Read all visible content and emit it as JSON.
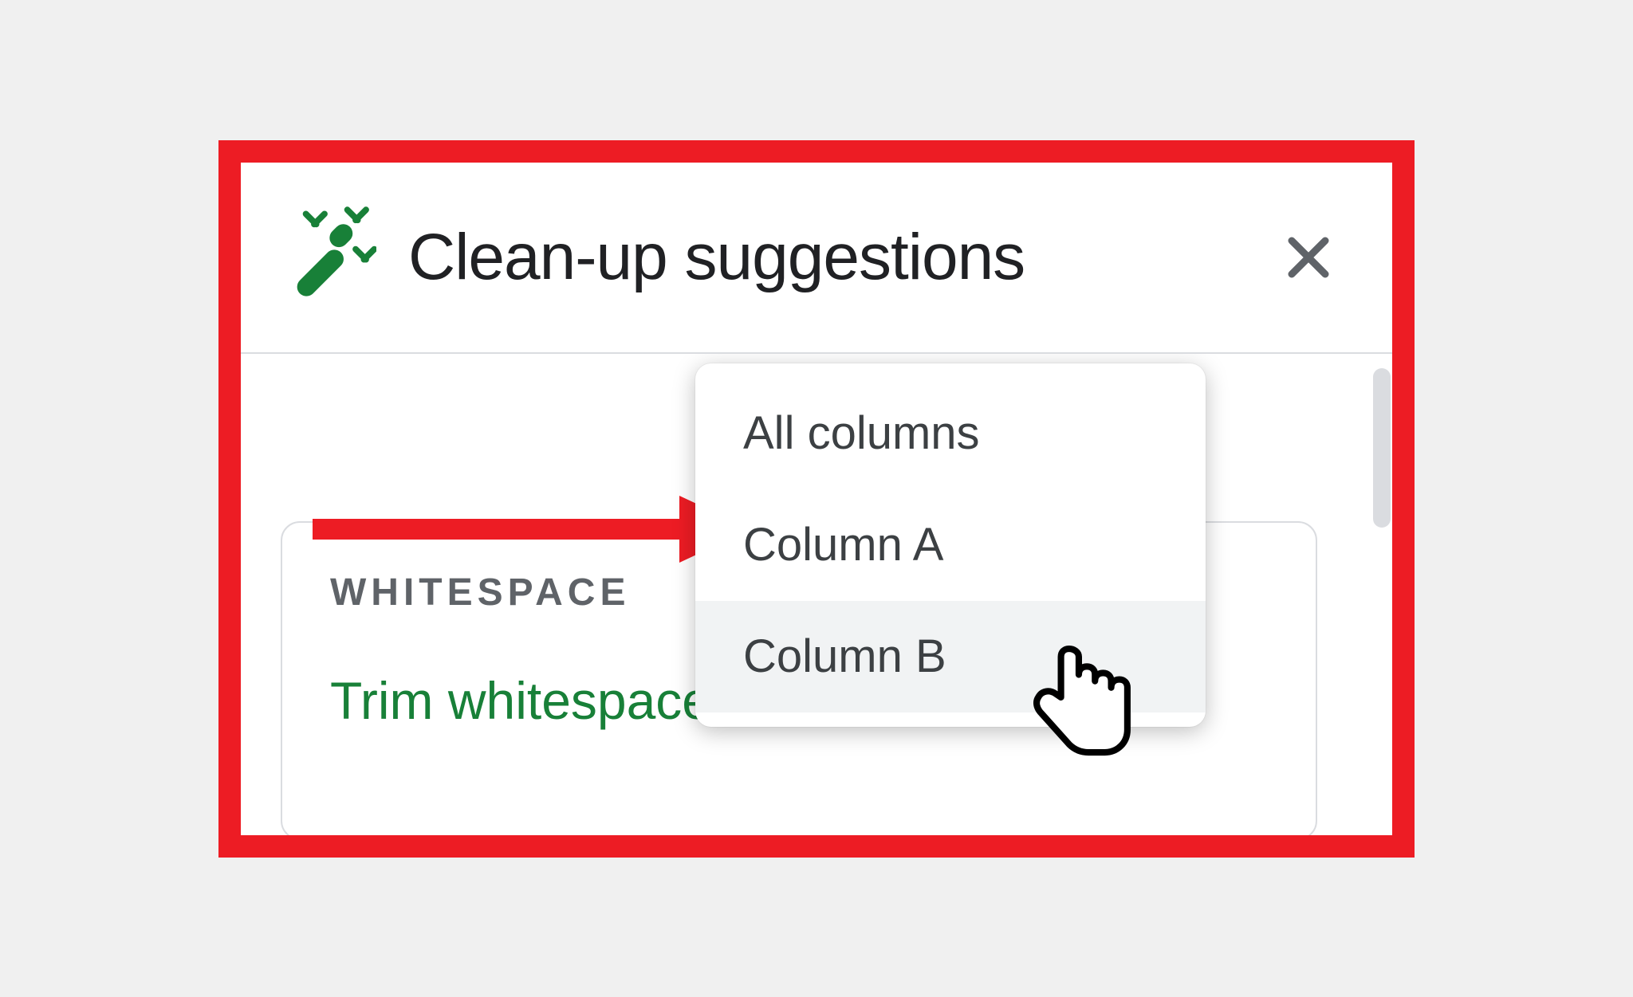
{
  "panel": {
    "title": "Clean-up suggestions"
  },
  "card": {
    "category": "WHITESPACE",
    "action": "Trim whitespace"
  },
  "menu": {
    "items": [
      {
        "label": "All columns",
        "hovered": false
      },
      {
        "label": "Column A",
        "hovered": false
      },
      {
        "label": "Column B",
        "hovered": true
      }
    ]
  },
  "colors": {
    "highlight_border": "#ed1c24",
    "arrow": "#ed1c24",
    "accent_green": "#188038"
  }
}
